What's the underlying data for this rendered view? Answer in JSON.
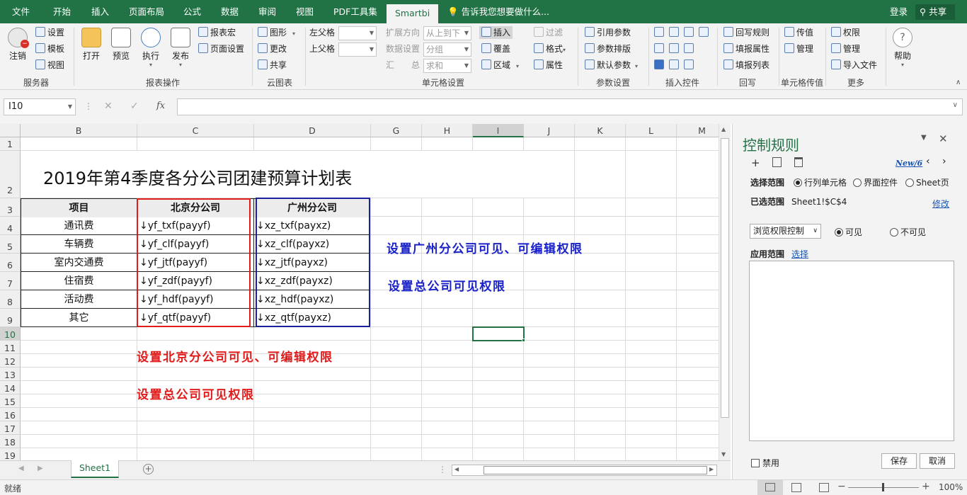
{
  "menu": {
    "tabs": [
      "文件",
      "开始",
      "插入",
      "页面布局",
      "公式",
      "数据",
      "审阅",
      "视图",
      "PDF工具集",
      "Smartbi"
    ],
    "active_tab": "Smartbi",
    "tell_me": "告诉我您想要做什么...",
    "login": "登录",
    "share": "共享"
  },
  "ribbon": {
    "server": {
      "logout": "注销",
      "settings": "设置",
      "template": "模板",
      "view": "视图",
      "label": "服务器"
    },
    "report_ops": {
      "open": "打开",
      "preview": "预览",
      "execute": "执行",
      "publish": "发布",
      "report_macro": "报表宏",
      "page_setup": "页面设置",
      "label": "报表操作"
    },
    "cloud_chart": {
      "chart": "图形",
      "update": "更改",
      "share": "共享",
      "label": "云图表"
    },
    "cell_settings": {
      "parent_left": "左父格",
      "parent_up": "上父格",
      "expand_dir": "扩展方向",
      "expand_dir_val": "从上到下",
      "data_setting": "数据设置",
      "data_setting_val": "分组",
      "summary": "汇　　总",
      "summary_val": "求和",
      "insert": "插入",
      "cover": "覆盖",
      "region": "区域",
      "filter": "过滤",
      "format": "格式",
      "attr": "属性",
      "label": "单元格设置"
    },
    "param_settings": {
      "ref_param": "引用参数",
      "param_layout": "参数排版",
      "default_param": "默认参数",
      "label": "参数设置"
    },
    "insert_ctrl": {
      "label": "插入控件"
    },
    "writeback": {
      "rule": "回写规则",
      "fill_attr": "填报属性",
      "fill_list": "填报列表",
      "label": "回写"
    },
    "cell_pass": {
      "pass": "传值",
      "manage": "管理",
      "label": "单元格传值"
    },
    "more": {
      "permission": "权限",
      "manage": "管理",
      "import_file": "导入文件",
      "label": "更多"
    },
    "help": "帮助"
  },
  "formula_bar": {
    "name_box": "I10",
    "formula": ""
  },
  "columns": [
    "B",
    "C",
    "D",
    "G",
    "H",
    "I",
    "J",
    "K",
    "L",
    "M"
  ],
  "selected_column": "I",
  "rows": [
    "1",
    "2",
    "3",
    "4",
    "5",
    "6",
    "7",
    "8",
    "9",
    "10",
    "11",
    "12",
    "13",
    "14",
    "15",
    "16",
    "17",
    "18",
    "19"
  ],
  "selected_row": "10",
  "sheet": {
    "title": "2019年第4季度各分公司团建预算计划表",
    "headers": [
      "项目",
      "北京分公司",
      "广州分公司"
    ],
    "items": [
      [
        "通讯费",
        "↓yf_txf(payyf)",
        "↓xz_txf(payxz)"
      ],
      [
        "车辆费",
        "↓yf_clf(payyf)",
        "↓xz_clf(payxz)"
      ],
      [
        "室内交通费",
        "↓yf_jtf(payyf)",
        "↓xz_jtf(payxz)"
      ],
      [
        "住宿费",
        "↓yf_zdf(payyf)",
        "↓xz_zdf(payxz)"
      ],
      [
        "活动费",
        "↓yf_hdf(payyf)",
        "↓xz_hdf(payxz)"
      ],
      [
        "其它",
        "↓yf_qtf(payyf)",
        "↓xz_qtf(payxz)"
      ]
    ],
    "note_gz_1": "设置广州分公司可见、可编辑权限",
    "note_gz_2": "设置总公司可见权限",
    "note_bj_1": "设置北京分公司可见、可编辑权限",
    "note_bj_2": "设置总公司可见权限",
    "blue": "#1a22c8",
    "red": "#e21b1b"
  },
  "sheet_tabs": [
    "Sheet1"
  ],
  "status": {
    "ready": "就绪",
    "zoom": "100%"
  },
  "panel": {
    "title": "控制规则",
    "new_link": "New/6",
    "select_range_label": "选择范围",
    "opt_cells": "行列单元格",
    "opt_controls": "界面控件",
    "opt_sheet": "Sheet页",
    "selected_label": "已选范围",
    "selected_value": "Sheet1!$C$4",
    "modify": "修改",
    "rule_type": "浏览权限控制",
    "visible": "可见",
    "invisible": "不可见",
    "apply_label": "应用范围",
    "choose": "选择",
    "disable": "禁用",
    "save": "保存",
    "cancel": "取消"
  }
}
